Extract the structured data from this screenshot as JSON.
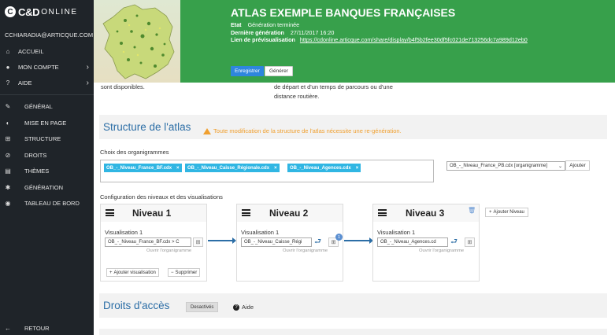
{
  "logo": {
    "circle": "C",
    "main": "C&D",
    "sub": "ONLINE"
  },
  "user": {
    "email": "CCHIARADIA@ARTICQUE.COM"
  },
  "nav": {
    "accueil": "ACCUEIL",
    "compte": "MON COMPTE",
    "aide": "AIDE",
    "general": "GÉNÉRAL",
    "mise_en_page": "MISE EN PAGE",
    "structure": "STRUCTURE",
    "droits": "DROITS",
    "themes": "THÈMES",
    "generation": "GÉNÉRATION",
    "tableau_de_bord": "TABLEAU DE BORD",
    "retour": "RETOUR"
  },
  "header": {
    "title": "ATLAS EXEMPLE BANQUES FRANÇAISES",
    "etat_label": "Etat",
    "etat_value": "Génération terminée",
    "derniere_label": "Dernière génération",
    "derniere_value": "27/11/2017 16:20",
    "lien_label": "Lien de prévisualisation",
    "lien_value": "https://cdonline.articque.com/share/display/b4f5b2fee30df5fc021de713256dc7a989d12eb0",
    "save_label": "Enregistrer",
    "generate_label": "Générer"
  },
  "fragments": {
    "left": "sont disponibles.",
    "right1": "de départ et d'un temps de parcours ou d'une",
    "right2": "distance routière."
  },
  "structure": {
    "title": "Structure de l'atlas",
    "warning": "Toute modification de la structure de l'atlas nécessite une re-génération.",
    "org_label": "Choix des organigrammes",
    "chips": [
      "OB_-_Niveau_France_BF.cdx",
      "OB_-_Niveau_Caisse_Régionale.cdx",
      "OB_-_Niveau_Agences.cdx"
    ],
    "chip_close": "×",
    "select_value": "OB_-_Niveau_France_PB.cdx [organigramme]",
    "add_label": "Ajouter",
    "config_label": "Configuration des niveaux et des visualisations",
    "add_level_label": "Ajouter Niveau",
    "levels": [
      {
        "title": "Niveau 1",
        "viz_label": "Visualisation 1",
        "viz_value": "OB_-_Niveau_France_BF.cdx > C",
        "open_org": "Ouvrir l'organigramme",
        "add_viz": "Ajouter visualisation",
        "remove": "Supprimer"
      },
      {
        "title": "Niveau 2",
        "viz_label": "Visualisation 1",
        "viz_value": "OB_-_Niveau_Caisse_Régi",
        "open_org": "Ouvrir l'organigramme",
        "badge": "1"
      },
      {
        "title": "Niveau 3",
        "viz_label": "Visualisation 1",
        "viz_value": "OB_-_Niveau_Agences.cd",
        "open_org": "Ouvrir l'organigramme"
      }
    ]
  },
  "droits": {
    "title": "Droits d'accès",
    "status": "Desactivés",
    "help": "Aide"
  },
  "colors": {
    "sidebar": "#1f2429",
    "header": "#37a04b",
    "accent": "#2c6ea6",
    "chip": "#30b6e3",
    "warning": "#f0a030"
  }
}
